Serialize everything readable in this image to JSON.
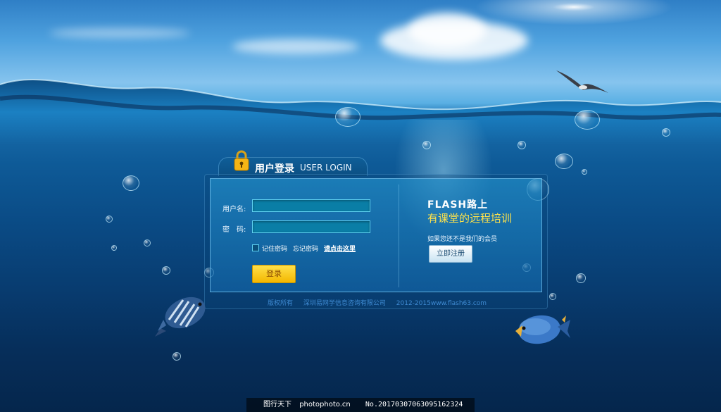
{
  "login": {
    "tab_title": "用户登录",
    "tab_subtitle": "USER LOGIN",
    "username_label": "用户名:",
    "password_label": "密　码:",
    "username_value": "",
    "password_value": "",
    "remember_label": "记住密码",
    "forgot_label": "忘记密码",
    "click_here_label": "请点击这里",
    "submit_label": "登录",
    "remember_checked": false
  },
  "promo": {
    "brand": "FLASH路上",
    "slogan": "有课堂的远程培训",
    "register_prompt": "如果您还不是我们的会员",
    "register_label": "立即注册"
  },
  "footer": {
    "copyright": "版权所有",
    "company": "深圳易网学信息咨询有限公司",
    "site": "2012-2015www.flash63.com"
  },
  "watermark": {
    "site": "图行天下",
    "url": "photophoto.cn",
    "id": "No.20170307063095162324"
  },
  "colors": {
    "accent_yellow": "#ffe34a",
    "button_yellow": "#f3b700",
    "panel_border": "#8cd7ff",
    "deep_sea": "#062e5a"
  },
  "icons": {
    "lock": "padlock-icon",
    "bird": "seagull",
    "fish": "tropical-fish"
  }
}
